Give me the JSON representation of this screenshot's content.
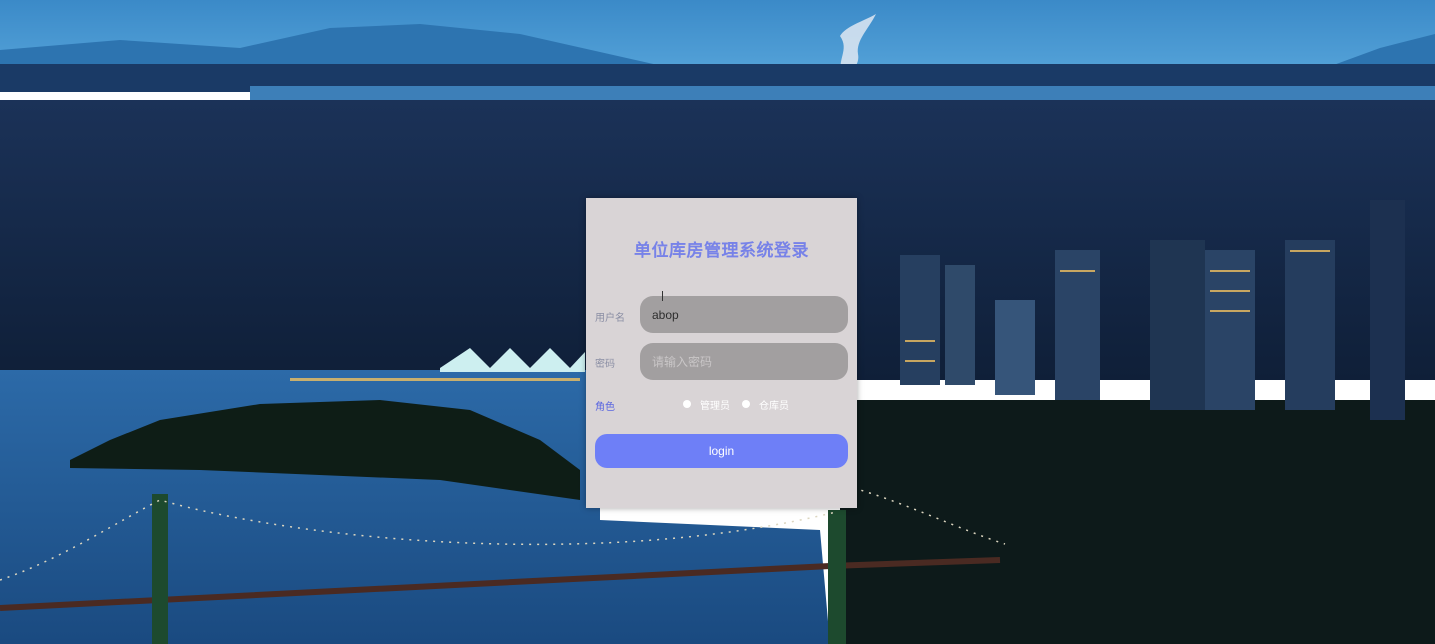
{
  "login": {
    "title": "单位库房管理系统登录",
    "username_label": "用户名",
    "username_value": "abop",
    "password_label": "密码",
    "password_placeholder": "请输入密码",
    "role_label": "角色",
    "roles": [
      "管理员",
      "仓库员"
    ],
    "login_button": "login"
  },
  "colors": {
    "card_bg": "#d9d4d6",
    "title": "#7782e8",
    "field_bg": "#a29fa0",
    "button": "#6e7ff7"
  }
}
